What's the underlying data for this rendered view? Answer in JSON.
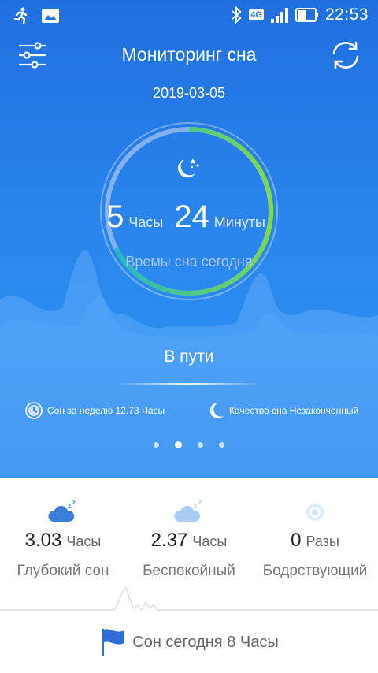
{
  "status_bar": {
    "time": "22:53",
    "network": "4G",
    "icons": [
      "running-icon",
      "image-icon",
      "bluetooth-icon",
      "signal-icon",
      "battery-icon"
    ]
  },
  "header": {
    "title": "Мониторинг сна",
    "menu_icon": "settings-sliders-icon",
    "sync_icon": "sync-icon"
  },
  "date": "2019-03-05",
  "sleep_ring": {
    "hours": "5",
    "hours_unit": "Часы",
    "minutes": "24",
    "minutes_unit": "Минуты",
    "caption": "Времы сна сегодня",
    "progress_fraction": 0.675,
    "colors": {
      "start": "#1fb5c8",
      "end": "#7fd94a",
      "track": "#8fb7ee"
    }
  },
  "status": {
    "text": "В пути"
  },
  "info": {
    "weekly": "Сон за неделю 12.73 Часы",
    "quality": "Качество сна Незаконченный"
  },
  "pager": {
    "count": 4,
    "active_index": 1
  },
  "stats": [
    {
      "value": "3.03",
      "unit": "Часы",
      "label": "Глубокий сон",
      "icon": "deep-sleep-cloud-icon",
      "color": "#3a7fd9"
    },
    {
      "value": "2.37",
      "unit": "Часы",
      "label": "Беспокойный",
      "icon": "light-sleep-cloud-icon",
      "color": "#a9ccf2"
    },
    {
      "value": "0",
      "unit": "Разы",
      "label": "Бодрствующий",
      "icon": "awake-eye-icon",
      "color": "#cfe4fa"
    }
  ],
  "footer": {
    "text": "Сон сегодня 8 Часы",
    "icon": "flag-icon"
  },
  "colors": {
    "hero_blue": "#2a84ec",
    "accent_blue": "#3a7fd9"
  }
}
